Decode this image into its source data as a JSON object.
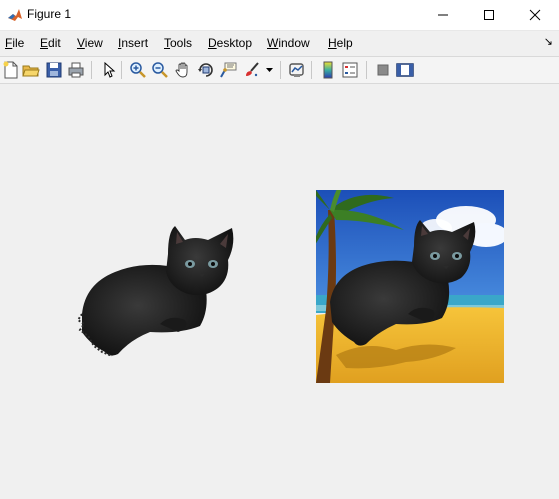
{
  "window": {
    "title": "Figure 1"
  },
  "menu": {
    "file": {
      "u": "F",
      "rest": "ile"
    },
    "edit": {
      "u": "E",
      "rest": "dit"
    },
    "view": {
      "u": "V",
      "rest": "iew"
    },
    "insert": {
      "u": "I",
      "rest": "nsert"
    },
    "tools": {
      "u": "T",
      "rest": "ools"
    },
    "desktop": {
      "u": "D",
      "rest": "esktop"
    },
    "window": {
      "u": "W",
      "rest": "indow"
    },
    "help": {
      "u": "H",
      "rest": "elp"
    },
    "overflow_arrow": "↘"
  },
  "toolbar": {
    "icons": [
      "new-figure-icon",
      "open-file-icon",
      "save-icon",
      "print-icon",
      "edit-pointer-icon",
      "zoom-in-icon",
      "zoom-out-icon",
      "pan-hand-icon",
      "rotate-3d-icon",
      "data-cursor-icon",
      "brush-icon",
      "link-plot-icon",
      "colorbar-icon",
      "legend-icon",
      "hide-plot-tools-icon",
      "show-plot-tools-icon"
    ]
  },
  "colors": {
    "background": "#f0f0f0",
    "sky": "#2b6fd6",
    "sand": "#f2b22a",
    "sea": "#3aa7c9",
    "cat": "#1c1c1c"
  }
}
